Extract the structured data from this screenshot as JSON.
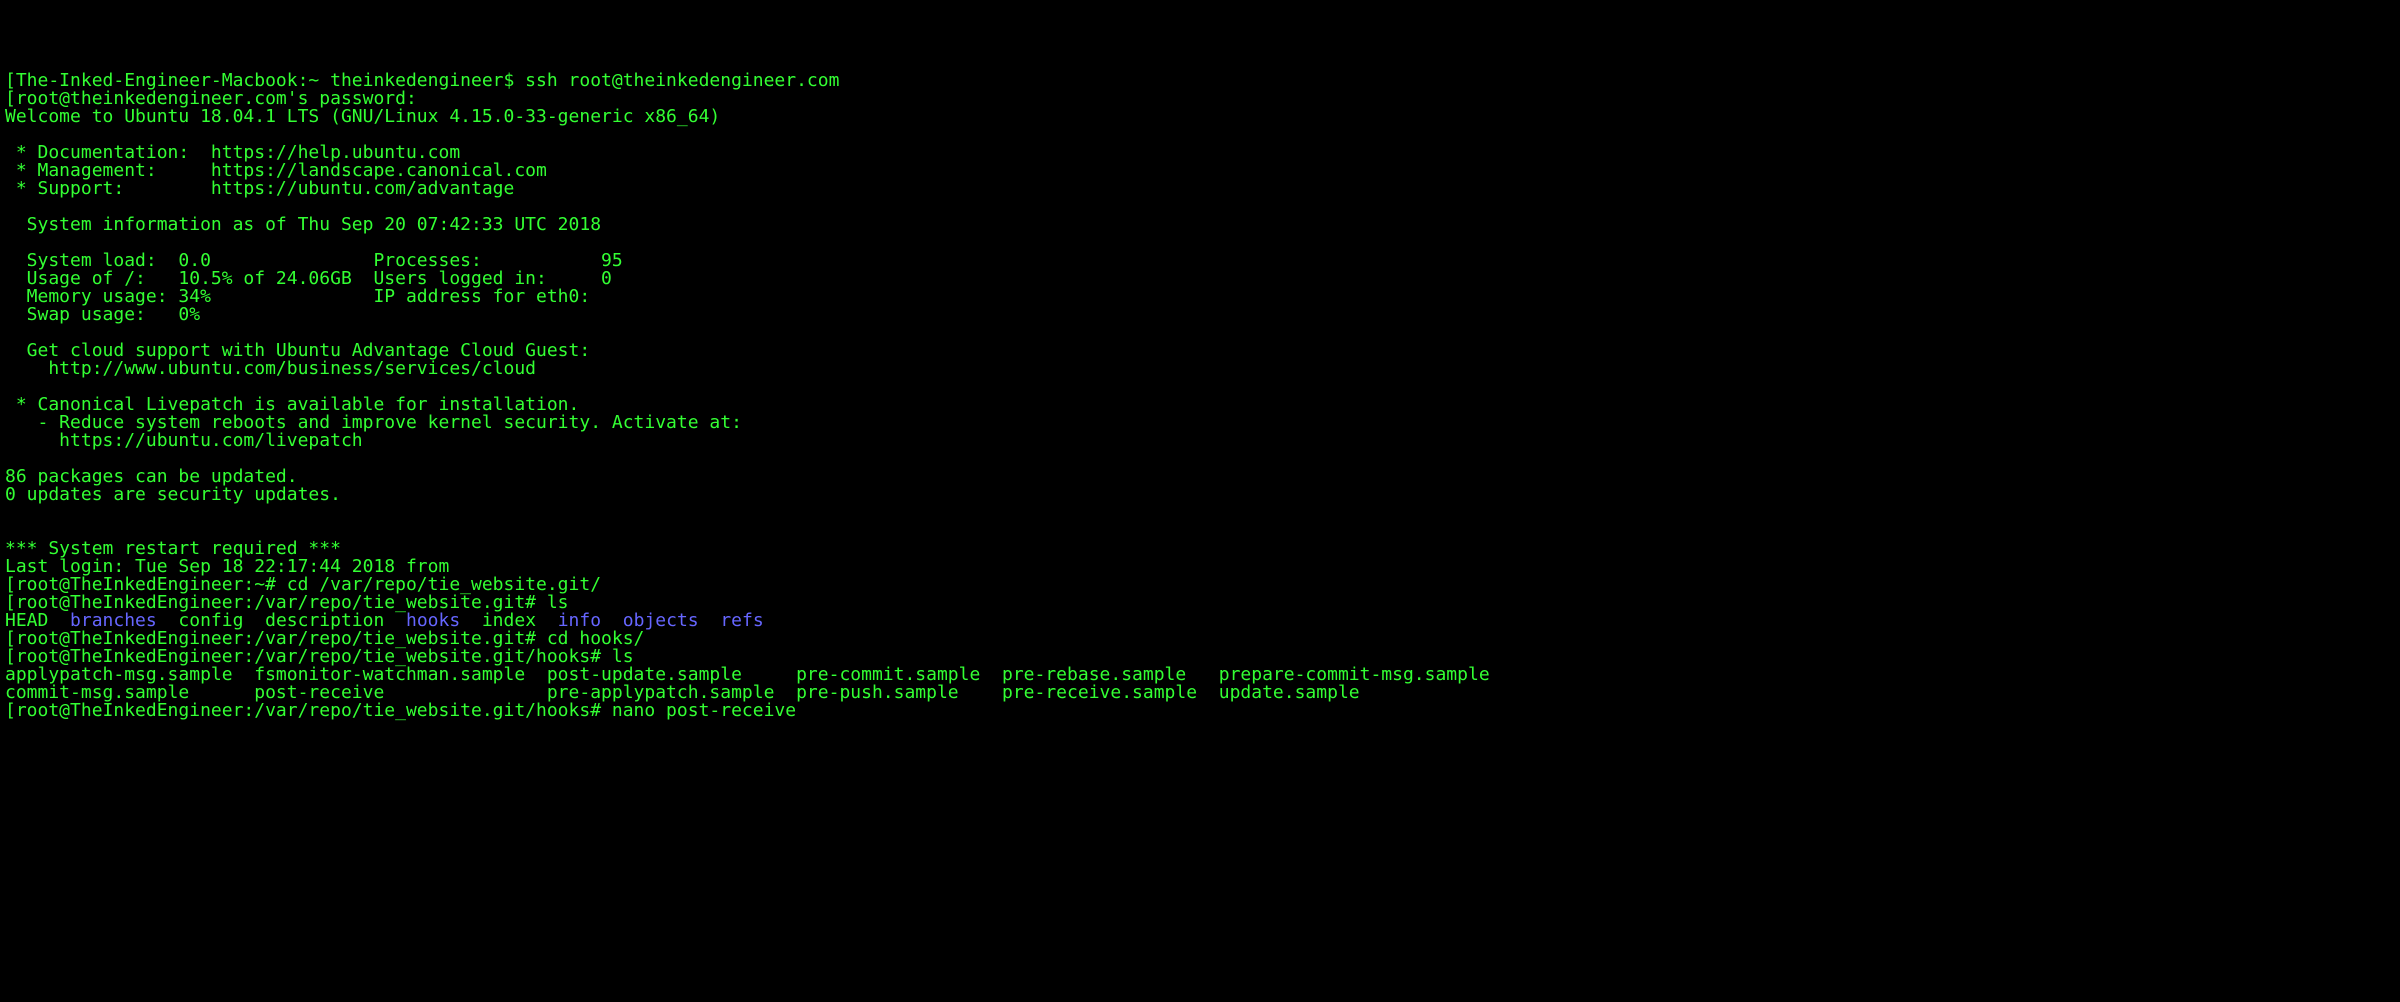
{
  "lines": [
    {
      "segments": [
        {
          "text": "[The-Inked-Engineer-Macbook:~ theinkedengineer$ ssh root@theinkedengineer.com",
          "cls": "green"
        }
      ]
    },
    {
      "segments": [
        {
          "text": "[root@theinkedengineer.com's password:",
          "cls": "green"
        }
      ]
    },
    {
      "segments": [
        {
          "text": "Welcome to Ubuntu 18.04.1 LTS (GNU/Linux 4.15.0-33-generic x86_64)",
          "cls": "green"
        }
      ]
    },
    {
      "blank": true
    },
    {
      "segments": [
        {
          "text": " * Documentation:  https://help.ubuntu.com",
          "cls": "green"
        }
      ]
    },
    {
      "segments": [
        {
          "text": " * Management:     https://landscape.canonical.com",
          "cls": "green"
        }
      ]
    },
    {
      "segments": [
        {
          "text": " * Support:        https://ubuntu.com/advantage",
          "cls": "green"
        }
      ]
    },
    {
      "blank": true
    },
    {
      "segments": [
        {
          "text": "  System information as of Thu Sep 20 07:42:33 UTC 2018",
          "cls": "green"
        }
      ]
    },
    {
      "blank": true
    },
    {
      "segments": [
        {
          "text": "  System load:  0.0               Processes:           95",
          "cls": "green"
        }
      ]
    },
    {
      "segments": [
        {
          "text": "  Usage of /:   10.5% of 24.06GB  Users logged in:     0",
          "cls": "green"
        }
      ]
    },
    {
      "segments": [
        {
          "text": "  Memory usage: 34%               IP address for eth0:",
          "cls": "green"
        }
      ]
    },
    {
      "segments": [
        {
          "text": "  Swap usage:   0%",
          "cls": "green"
        }
      ]
    },
    {
      "blank": true
    },
    {
      "segments": [
        {
          "text": "  Get cloud support with Ubuntu Advantage Cloud Guest:",
          "cls": "green"
        }
      ]
    },
    {
      "segments": [
        {
          "text": "    http://www.ubuntu.com/business/services/cloud",
          "cls": "green"
        }
      ]
    },
    {
      "blank": true
    },
    {
      "segments": [
        {
          "text": " * Canonical Livepatch is available for installation.",
          "cls": "green"
        }
      ]
    },
    {
      "segments": [
        {
          "text": "   - Reduce system reboots and improve kernel security. Activate at:",
          "cls": "green"
        }
      ]
    },
    {
      "segments": [
        {
          "text": "     https://ubuntu.com/livepatch",
          "cls": "green"
        }
      ]
    },
    {
      "blank": true
    },
    {
      "segments": [
        {
          "text": "86 packages can be updated.",
          "cls": "green"
        }
      ]
    },
    {
      "segments": [
        {
          "text": "0 updates are security updates.",
          "cls": "green"
        }
      ]
    },
    {
      "blank": true
    },
    {
      "blank": true
    },
    {
      "segments": [
        {
          "text": "*** System restart required ***",
          "cls": "green"
        }
      ]
    },
    {
      "segments": [
        {
          "text": "Last login: Tue Sep 18 22:17:44 2018 from",
          "cls": "green"
        }
      ]
    },
    {
      "segments": [
        {
          "text": "[root@TheInkedEngineer:~# cd /var/repo/tie_website.git/",
          "cls": "green"
        }
      ]
    },
    {
      "segments": [
        {
          "text": "[root@TheInkedEngineer:/var/repo/tie_website.git# ls",
          "cls": "green"
        }
      ]
    },
    {
      "segments": [
        {
          "text": "HEAD  ",
          "cls": "green"
        },
        {
          "text": "branches",
          "cls": "dir"
        },
        {
          "text": "  config  description  ",
          "cls": "green"
        },
        {
          "text": "hooks",
          "cls": "dir"
        },
        {
          "text": "  index  ",
          "cls": "green"
        },
        {
          "text": "info",
          "cls": "dir"
        },
        {
          "text": "  ",
          "cls": "green"
        },
        {
          "text": "objects",
          "cls": "dir"
        },
        {
          "text": "  ",
          "cls": "green"
        },
        {
          "text": "refs",
          "cls": "dir"
        }
      ]
    },
    {
      "segments": [
        {
          "text": "[root@TheInkedEngineer:/var/repo/tie_website.git# cd hooks/",
          "cls": "green"
        }
      ]
    },
    {
      "segments": [
        {
          "text": "[root@TheInkedEngineer:/var/repo/tie_website.git/hooks# ls",
          "cls": "green"
        }
      ]
    },
    {
      "segments": [
        {
          "text": "applypatch-msg.sample  fsmonitor-watchman.sample  post-update.sample     pre-commit.sample  pre-rebase.sample   prepare-commit-msg.sample",
          "cls": "green"
        }
      ]
    },
    {
      "segments": [
        {
          "text": "commit-msg.sample      post-receive               pre-applypatch.sample  pre-push.sample    pre-receive.sample  update.sample",
          "cls": "green"
        }
      ]
    },
    {
      "segments": [
        {
          "text": "[root@TheInkedEngineer:/var/repo/tie_website.git/hooks# nano post-receive",
          "cls": "green"
        }
      ]
    }
  ]
}
